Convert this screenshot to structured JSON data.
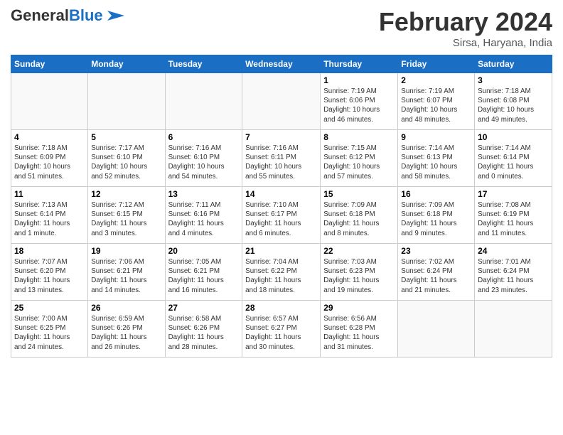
{
  "header": {
    "logo_line1": "General",
    "logo_line2": "Blue",
    "month": "February 2024",
    "location": "Sirsa, Haryana, India"
  },
  "days_of_week": [
    "Sunday",
    "Monday",
    "Tuesday",
    "Wednesday",
    "Thursday",
    "Friday",
    "Saturday"
  ],
  "weeks": [
    [
      {
        "day": "",
        "info": ""
      },
      {
        "day": "",
        "info": ""
      },
      {
        "day": "",
        "info": ""
      },
      {
        "day": "",
        "info": ""
      },
      {
        "day": "1",
        "info": "Sunrise: 7:19 AM\nSunset: 6:06 PM\nDaylight: 10 hours\nand 46 minutes."
      },
      {
        "day": "2",
        "info": "Sunrise: 7:19 AM\nSunset: 6:07 PM\nDaylight: 10 hours\nand 48 minutes."
      },
      {
        "day": "3",
        "info": "Sunrise: 7:18 AM\nSunset: 6:08 PM\nDaylight: 10 hours\nand 49 minutes."
      }
    ],
    [
      {
        "day": "4",
        "info": "Sunrise: 7:18 AM\nSunset: 6:09 PM\nDaylight: 10 hours\nand 51 minutes."
      },
      {
        "day": "5",
        "info": "Sunrise: 7:17 AM\nSunset: 6:10 PM\nDaylight: 10 hours\nand 52 minutes."
      },
      {
        "day": "6",
        "info": "Sunrise: 7:16 AM\nSunset: 6:10 PM\nDaylight: 10 hours\nand 54 minutes."
      },
      {
        "day": "7",
        "info": "Sunrise: 7:16 AM\nSunset: 6:11 PM\nDaylight: 10 hours\nand 55 minutes."
      },
      {
        "day": "8",
        "info": "Sunrise: 7:15 AM\nSunset: 6:12 PM\nDaylight: 10 hours\nand 57 minutes."
      },
      {
        "day": "9",
        "info": "Sunrise: 7:14 AM\nSunset: 6:13 PM\nDaylight: 10 hours\nand 58 minutes."
      },
      {
        "day": "10",
        "info": "Sunrise: 7:14 AM\nSunset: 6:14 PM\nDaylight: 11 hours\nand 0 minutes."
      }
    ],
    [
      {
        "day": "11",
        "info": "Sunrise: 7:13 AM\nSunset: 6:14 PM\nDaylight: 11 hours\nand 1 minute."
      },
      {
        "day": "12",
        "info": "Sunrise: 7:12 AM\nSunset: 6:15 PM\nDaylight: 11 hours\nand 3 minutes."
      },
      {
        "day": "13",
        "info": "Sunrise: 7:11 AM\nSunset: 6:16 PM\nDaylight: 11 hours\nand 4 minutes."
      },
      {
        "day": "14",
        "info": "Sunrise: 7:10 AM\nSunset: 6:17 PM\nDaylight: 11 hours\nand 6 minutes."
      },
      {
        "day": "15",
        "info": "Sunrise: 7:09 AM\nSunset: 6:18 PM\nDaylight: 11 hours\nand 8 minutes."
      },
      {
        "day": "16",
        "info": "Sunrise: 7:09 AM\nSunset: 6:18 PM\nDaylight: 11 hours\nand 9 minutes."
      },
      {
        "day": "17",
        "info": "Sunrise: 7:08 AM\nSunset: 6:19 PM\nDaylight: 11 hours\nand 11 minutes."
      }
    ],
    [
      {
        "day": "18",
        "info": "Sunrise: 7:07 AM\nSunset: 6:20 PM\nDaylight: 11 hours\nand 13 minutes."
      },
      {
        "day": "19",
        "info": "Sunrise: 7:06 AM\nSunset: 6:21 PM\nDaylight: 11 hours\nand 14 minutes."
      },
      {
        "day": "20",
        "info": "Sunrise: 7:05 AM\nSunset: 6:21 PM\nDaylight: 11 hours\nand 16 minutes."
      },
      {
        "day": "21",
        "info": "Sunrise: 7:04 AM\nSunset: 6:22 PM\nDaylight: 11 hours\nand 18 minutes."
      },
      {
        "day": "22",
        "info": "Sunrise: 7:03 AM\nSunset: 6:23 PM\nDaylight: 11 hours\nand 19 minutes."
      },
      {
        "day": "23",
        "info": "Sunrise: 7:02 AM\nSunset: 6:24 PM\nDaylight: 11 hours\nand 21 minutes."
      },
      {
        "day": "24",
        "info": "Sunrise: 7:01 AM\nSunset: 6:24 PM\nDaylight: 11 hours\nand 23 minutes."
      }
    ],
    [
      {
        "day": "25",
        "info": "Sunrise: 7:00 AM\nSunset: 6:25 PM\nDaylight: 11 hours\nand 24 minutes."
      },
      {
        "day": "26",
        "info": "Sunrise: 6:59 AM\nSunset: 6:26 PM\nDaylight: 11 hours\nand 26 minutes."
      },
      {
        "day": "27",
        "info": "Sunrise: 6:58 AM\nSunset: 6:26 PM\nDaylight: 11 hours\nand 28 minutes."
      },
      {
        "day": "28",
        "info": "Sunrise: 6:57 AM\nSunset: 6:27 PM\nDaylight: 11 hours\nand 30 minutes."
      },
      {
        "day": "29",
        "info": "Sunrise: 6:56 AM\nSunset: 6:28 PM\nDaylight: 11 hours\nand 31 minutes."
      },
      {
        "day": "",
        "info": ""
      },
      {
        "day": "",
        "info": ""
      }
    ]
  ]
}
